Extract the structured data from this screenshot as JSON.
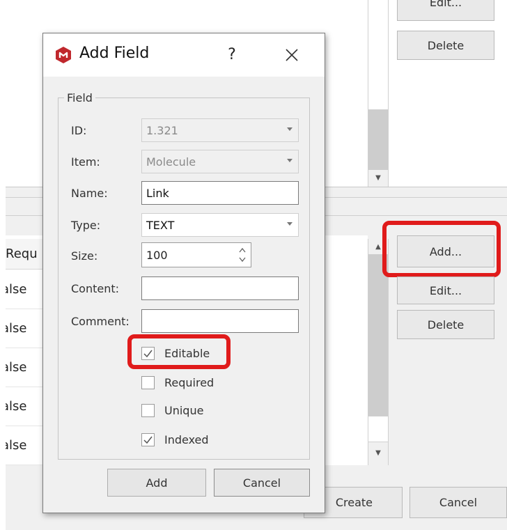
{
  "background": {
    "top_buttons": {
      "edit_label": "Edit...",
      "delete_label": "Delete"
    },
    "mid_buttons": {
      "add_label": "Add...",
      "edit_label": "Edit...",
      "delete_label": "Delete"
    },
    "table": {
      "column_header": "Requ",
      "rows": [
        "alse",
        "alse",
        "alse",
        "alse",
        "alse"
      ]
    },
    "bottom_buttons": {
      "create_label": "Create",
      "cancel_label": "Cancel"
    }
  },
  "dialog": {
    "title": "Add Field",
    "help_label": "?",
    "group_label": "Field",
    "fields": {
      "id": {
        "label": "ID:",
        "value": "1.321"
      },
      "item": {
        "label": "Item:",
        "value": "Molecule"
      },
      "name": {
        "label": "Name:",
        "value": "Link"
      },
      "type": {
        "label": "Type:",
        "value": "TEXT"
      },
      "size": {
        "label": "Size:",
        "value": "100"
      },
      "content": {
        "label": "Content:",
        "value": ""
      },
      "comment": {
        "label": "Comment:",
        "value": ""
      }
    },
    "checkboxes": [
      {
        "label": "Editable",
        "checked": true
      },
      {
        "label": "Required",
        "checked": false
      },
      {
        "label": "Unique",
        "checked": false
      },
      {
        "label": "Indexed",
        "checked": true
      }
    ],
    "buttons": {
      "add_label": "Add",
      "cancel_label": "Cancel"
    }
  },
  "colors": {
    "highlight": "#e01b1b",
    "app_icon": "#c0282d"
  },
  "icons": [
    "app-logo-icon",
    "close-icon",
    "chevron-down-icon",
    "spin-arrows-icon",
    "checkmark-icon",
    "scroll-up-icon",
    "scroll-down-icon"
  ]
}
